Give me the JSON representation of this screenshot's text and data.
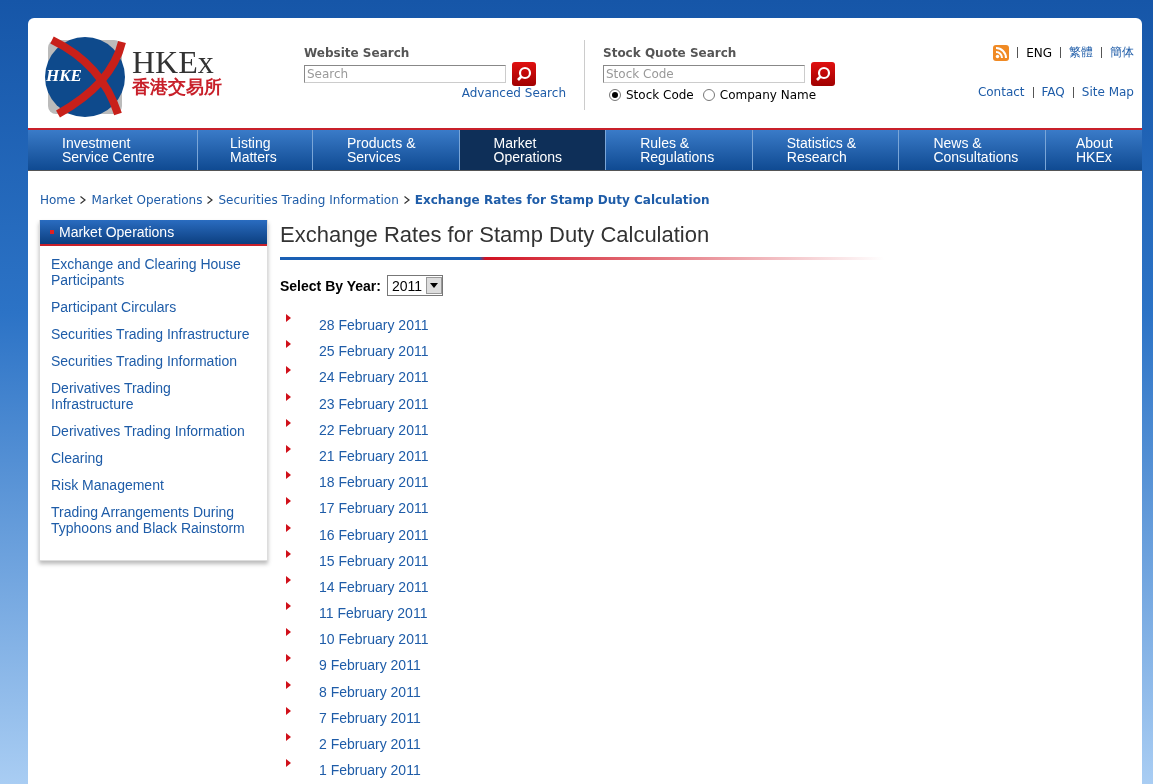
{
  "logo": {
    "mark_text": "HKE",
    "name": "HKEx",
    "name_chinese": "香港交易所"
  },
  "website_search": {
    "title": "Website Search",
    "placeholder": "Search",
    "advanced_link": "Advanced Search"
  },
  "stock_quote_search": {
    "title": "Stock Quote Search",
    "placeholder": "Stock Code",
    "options": [
      {
        "label": "Stock Code",
        "selected": true
      },
      {
        "label": "Company Name",
        "selected": false
      }
    ]
  },
  "languages": [
    {
      "label": "ENG",
      "selected": true
    },
    {
      "label": "繁體",
      "selected": false
    },
    {
      "label": "簡体",
      "selected": false
    }
  ],
  "utility_links": [
    "Contact",
    "FAQ",
    "Site Map"
  ],
  "nav": [
    {
      "lines": [
        "Investment",
        "Service Centre"
      ],
      "selected": false
    },
    {
      "lines": [
        "Listing",
        "Matters"
      ],
      "selected": false
    },
    {
      "lines": [
        "Products &",
        "Services"
      ],
      "selected": false
    },
    {
      "lines": [
        "Market",
        "Operations"
      ],
      "selected": true
    },
    {
      "lines": [
        "Rules &",
        "Regulations"
      ],
      "selected": false
    },
    {
      "lines": [
        "Statistics &",
        "Research"
      ],
      "selected": false
    },
    {
      "lines": [
        "News &",
        "Consultations"
      ],
      "selected": false
    },
    {
      "lines": [
        "About",
        "HKEx"
      ],
      "selected": false
    }
  ],
  "breadcrumb": [
    {
      "label": "Home",
      "current": false
    },
    {
      "label": "Market Operations",
      "current": false
    },
    {
      "label": "Securities Trading Information",
      "current": false
    },
    {
      "label": "Exchange Rates for Stamp Duty Calculation",
      "current": true
    }
  ],
  "sidebar": {
    "title": "Market Operations",
    "items": [
      "Exchange and Clearing House Participants",
      "Participant Circulars",
      "Securities Trading Infrastructure",
      "Securities Trading Information",
      "Derivatives Trading Infrastructure",
      "Derivatives Trading Information",
      "Clearing",
      "Risk Management",
      "Trading Arrangements During Typhoons and Black Rainstorm"
    ]
  },
  "page_title": "Exchange Rates for Stamp Duty Calculation",
  "year_select": {
    "label": "Select By Year:",
    "value": "2011"
  },
  "dates": [
    "28 February 2011",
    "25 February 2011",
    "24 February 2011",
    "23 February 2011",
    "22 February 2011",
    "21 February 2011",
    "18 February 2011",
    "17 February 2011",
    "16 February 2011",
    "15 February 2011",
    "14 February 2011",
    "11 February 2011",
    "10 February 2011",
    "9 February 2011",
    "8 February 2011",
    "7 February 2011",
    "2 February 2011",
    "1 February 2011"
  ]
}
